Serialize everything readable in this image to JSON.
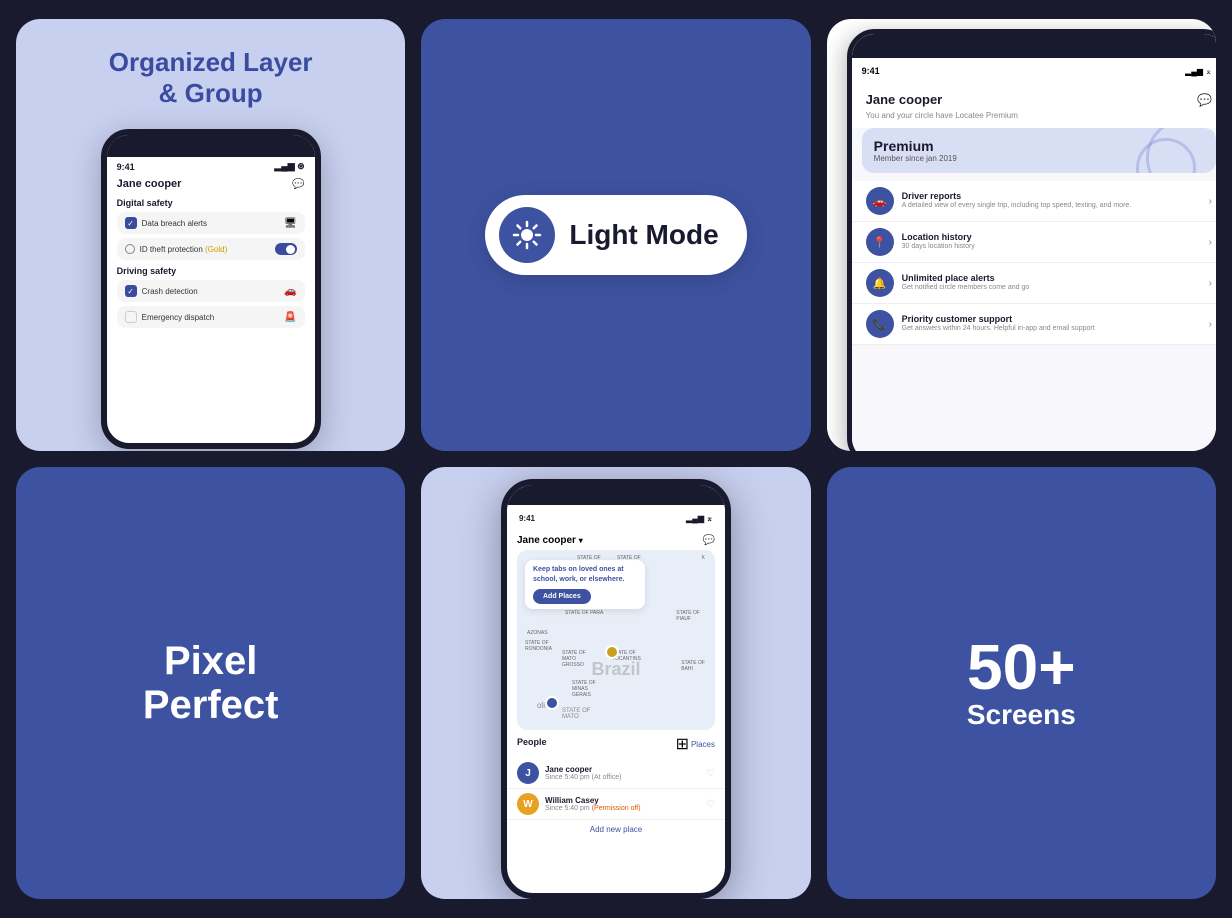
{
  "cards": {
    "top_left": {
      "title": "Organized Layer\n& Group",
      "phone": {
        "time": "9:41",
        "signal": "▂▄▆ ⌅",
        "user": "Jane cooper",
        "sections": [
          {
            "label": "Digital safety",
            "items": [
              {
                "checked": true,
                "text": "Data breach alerts",
                "icon": "monitor"
              },
              {
                "checked": false,
                "text": "ID theft protection",
                "badge": "Gold",
                "toggle": true
              }
            ]
          },
          {
            "label": "Driving safety",
            "items": [
              {
                "checked": true,
                "text": "Crash detection",
                "icon": "car"
              },
              {
                "checked": false,
                "text": "Emergency dispatch",
                "icon": "dispatch"
              }
            ]
          }
        ]
      }
    },
    "top_center": {
      "mode_label": "Light Mode"
    },
    "top_right": {
      "user": "Jane cooper",
      "subtitle": "You and your circle have Locatee Premium",
      "premium_label": "Premium",
      "member_since": "Member since jan 2019",
      "features": [
        {
          "icon": "🚗",
          "title": "Driver reports",
          "desc": "A detailed view of every single trip, including top speed, texting, and more."
        },
        {
          "icon": "📍",
          "title": "Location history",
          "desc": "30 days location history"
        },
        {
          "icon": "🔔",
          "title": "Unlimited place alerts",
          "desc": "Get notified circle members come and go"
        },
        {
          "icon": "📞",
          "title": "Priority customer support",
          "desc": "Get answers within 24 hours. Helpful in-app and email support"
        }
      ]
    },
    "bottom_left": {
      "line1": "Pixel",
      "line2": "Perfect"
    },
    "bottom_center": {
      "time": "9:41",
      "user": "Jane cooper",
      "map_text": "Keep tabs on loved ones at school, work, or elsewhere.",
      "add_places": "Add Places",
      "brazil": "Brazil",
      "states": [
        "STATE OF",
        "STATE OF\nRONDONIA",
        "STATE OF\nMATO\nGROSSO",
        "STATE OF\nMINAS\nGERAIS",
        "STATE OF\nTOCANTINS",
        "STATE OF\nBAHI",
        "STATE OF\nPARA",
        "STATE OF\nPIAUI",
        "MAKANHAO"
      ],
      "people_label": "People",
      "people": [
        {
          "name": "Jane cooper",
          "status": "Since 5:40 pm (At office)",
          "avatar_letter": "J",
          "avatar_color": "#3d52a0",
          "permission": false
        },
        {
          "name": "William Casey",
          "status": "Since 5:40 pm",
          "status_extra": "(Permission off)",
          "avatar_letter": "W",
          "avatar_color": "#e8a020",
          "permission": true
        }
      ],
      "add_new_place": "Add new place",
      "places_link": "Places"
    },
    "bottom_right": {
      "count": "50+",
      "label": "Screens"
    }
  }
}
